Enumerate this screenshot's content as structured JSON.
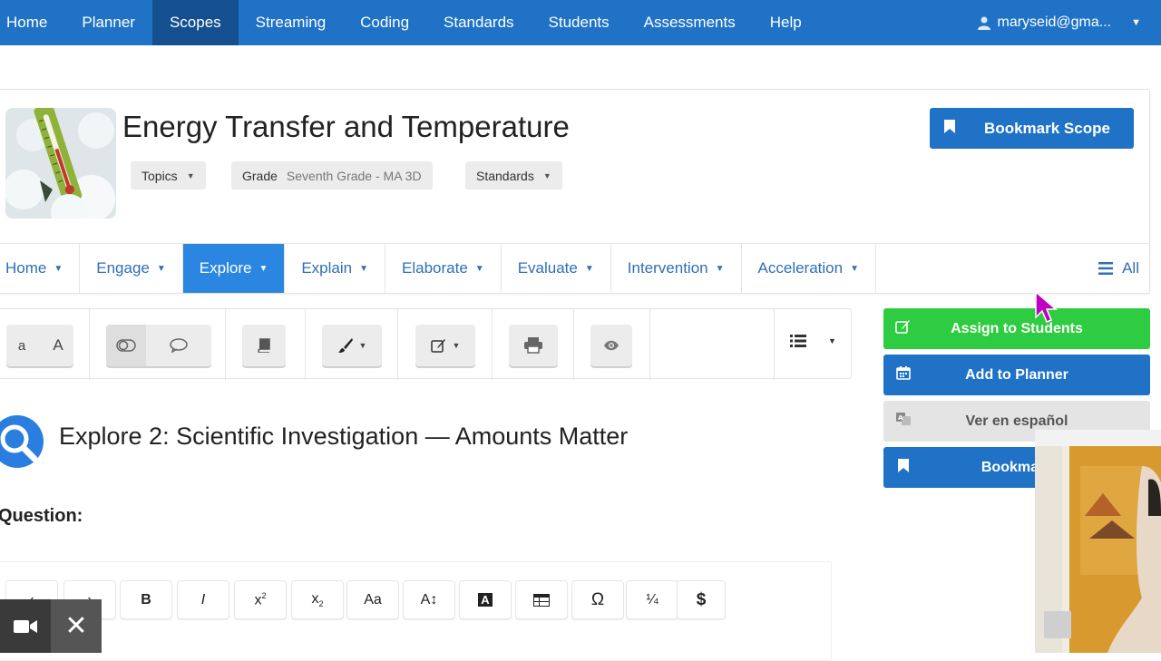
{
  "topnav": {
    "items": [
      {
        "label": "Home"
      },
      {
        "label": "Planner"
      },
      {
        "label": "Scopes"
      },
      {
        "label": "Streaming"
      },
      {
        "label": "Coding"
      },
      {
        "label": "Standards"
      },
      {
        "label": "Students"
      },
      {
        "label": "Assessments"
      },
      {
        "label": "Help"
      }
    ],
    "active": "Scopes",
    "user": "maryseid@gma..."
  },
  "scope": {
    "title": "Energy Transfer and Temperature",
    "topics_label": "Topics",
    "grade_label": "Grade",
    "grade_value": "Seventh Grade - MA 3D",
    "standards_label": "Standards",
    "bookmark_label": "Bookmark Scope"
  },
  "tabs": [
    {
      "label": "Home"
    },
    {
      "label": "Engage"
    },
    {
      "label": "Explore"
    },
    {
      "label": "Explain"
    },
    {
      "label": "Elaborate"
    },
    {
      "label": "Evaluate"
    },
    {
      "label": "Intervention"
    },
    {
      "label": "Acceleration"
    }
  ],
  "tabs_all": "All",
  "toolbar": {
    "font_small": "a",
    "font_large": "A"
  },
  "side_actions": {
    "assign": "Assign to Students",
    "planner": "Add to Planner",
    "spanish": "Ver en español",
    "bookmark": "Bookmark"
  },
  "section": {
    "title": "Explore 2: Scientific Investigation — Amounts Matter",
    "question_label": "Question:"
  },
  "editor": {
    "bold": "B",
    "italic": "I",
    "superscript_base": "x",
    "superscript_exp": "2",
    "subscript_base": "x",
    "subscript_sub": "2",
    "font_case": "Aa",
    "font_size": "A↕",
    "highlight": "A",
    "omega": "Ω",
    "fraction": "¼",
    "dollar": "$"
  },
  "colors": {
    "nav": "#1f72c6",
    "nav_active": "#14508f",
    "tab_active": "#2a86e0",
    "assign_green": "#2ecc40",
    "planner_blue": "#1f72c6",
    "spanish_gray": "#e4e4e4"
  }
}
